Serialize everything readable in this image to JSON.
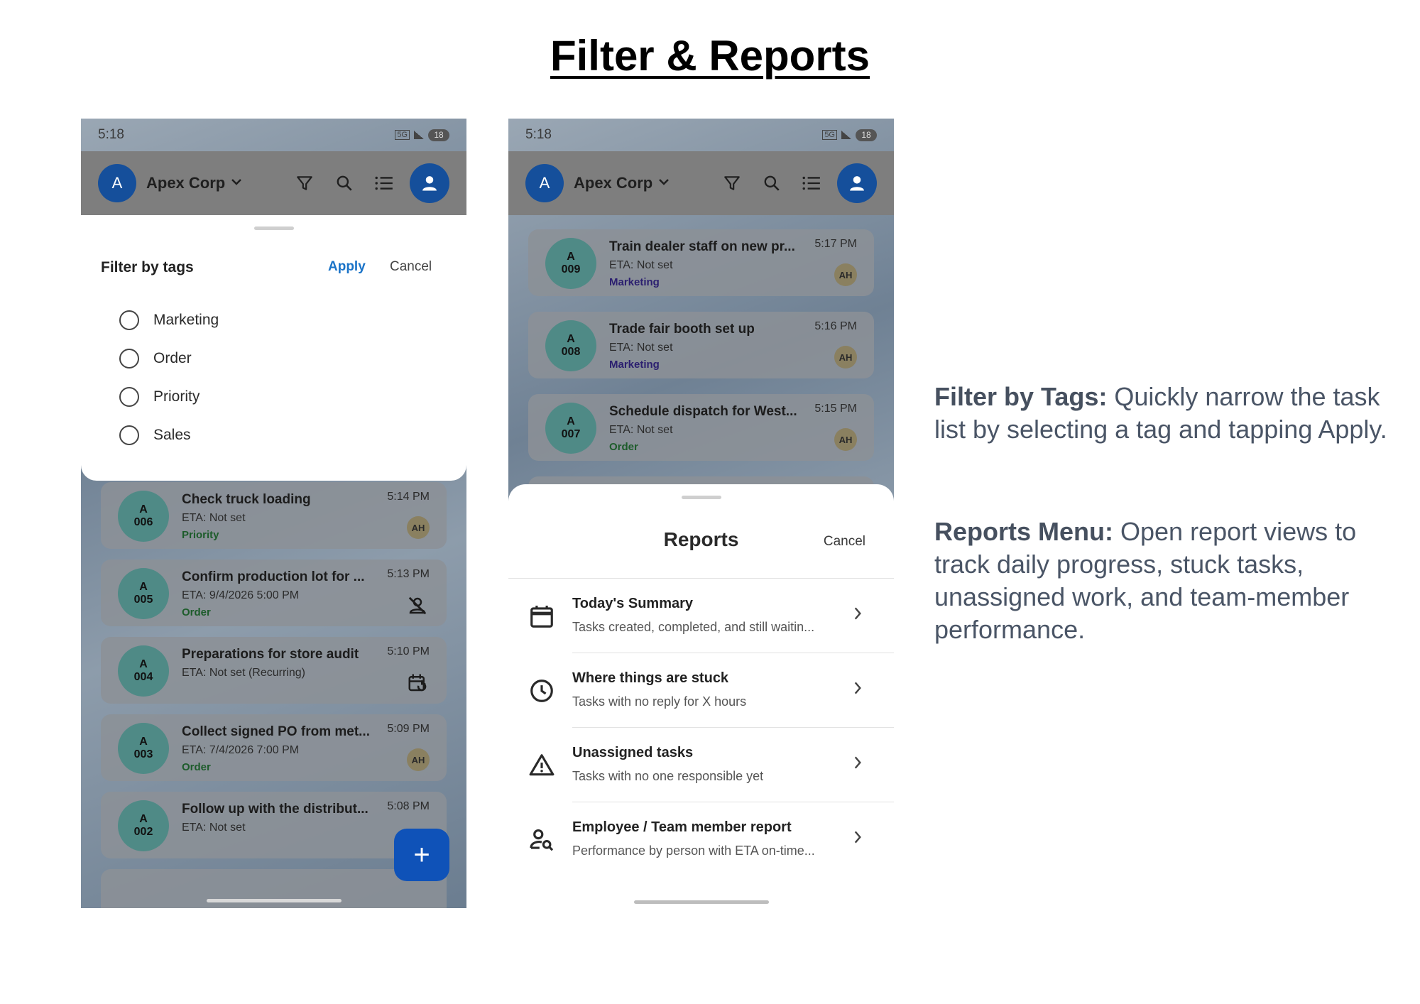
{
  "page": {
    "title": "Filter & Reports"
  },
  "left_phone": {
    "status": {
      "time": "5:18",
      "battery": "18"
    },
    "app_bar": {
      "org_initial": "A",
      "org_name": "Apex Corp"
    },
    "filter_sheet": {
      "title": "Filter by tags",
      "apply_label": "Apply",
      "cancel_label": "Cancel",
      "tags": [
        "Marketing",
        "Order",
        "Priority",
        "Sales"
      ]
    },
    "tasks": [
      {
        "initial": "A",
        "code": "006",
        "title": "Check truck loading",
        "eta": "ETA: Not set",
        "tag": "Priority",
        "time": "5:14 PM",
        "badge": "AH"
      },
      {
        "initial": "A",
        "code": "005",
        "title": "Confirm production lot for ...",
        "eta": "ETA: 9/4/2026 5:00 PM",
        "tag": "Order",
        "time": "5:13 PM",
        "icon": "unassigned-user-icon"
      },
      {
        "initial": "A",
        "code": "004",
        "title": "Preparations for store audit",
        "eta": "ETA: Not set (Recurring)",
        "time": "5:10 PM",
        "icon": "recurring-calendar-icon"
      },
      {
        "initial": "A",
        "code": "003",
        "title": "Collect signed PO from met...",
        "eta": "ETA: 7/4/2026 7:00 PM",
        "tag": "Order",
        "time": "5:09 PM",
        "badge": "AH"
      },
      {
        "initial": "A",
        "code": "002",
        "title": "Follow up with the distribut...",
        "eta": "ETA: Not set",
        "time": "5:08 PM"
      }
    ],
    "fab_label": "+"
  },
  "right_phone": {
    "status": {
      "time": "5:18",
      "battery": "18"
    },
    "app_bar": {
      "org_initial": "A",
      "org_name": "Apex Corp"
    },
    "tasks": [
      {
        "initial": "A",
        "code": "009",
        "title": "Train dealer staff on new pr...",
        "eta": "ETA: Not set",
        "tag": "Marketing",
        "time": "5:17 PM",
        "badge": "AH"
      },
      {
        "initial": "A",
        "code": "008",
        "title": "Trade fair booth set up",
        "eta": "ETA: Not set",
        "tag": "Marketing",
        "time": "5:16 PM",
        "badge": "AH"
      },
      {
        "initial": "A",
        "code": "007",
        "title": "Schedule dispatch for West...",
        "eta": "ETA: Not set",
        "tag": "Order",
        "time": "5:15 PM",
        "badge": "AH"
      }
    ],
    "reports_sheet": {
      "title": "Reports",
      "cancel_label": "Cancel",
      "items": [
        {
          "icon": "calendar-icon",
          "title": "Today's Summary",
          "subtitle": "Tasks created, completed, and still waitin..."
        },
        {
          "icon": "clock-icon",
          "title": "Where things are stuck",
          "subtitle": "Tasks with no reply for X hours"
        },
        {
          "icon": "warning-icon",
          "title": "Unassigned tasks",
          "subtitle": "Tasks with no one responsible yet"
        },
        {
          "icon": "person-search-icon",
          "title": "Employee / Team member report",
          "subtitle": "Performance by person with ETA on-time..."
        }
      ]
    }
  },
  "descriptions": [
    {
      "heading": "Filter by Tags:",
      "text": " Quickly narrow the task list by selecting a tag and tapping Apply."
    },
    {
      "heading": "Reports Menu:",
      "text": " Open report views to track daily progress, stuck tasks, unassigned work, and team-member performance."
    }
  ],
  "colors": {
    "primary_blue": "#154f9b",
    "apply_blue": "#1a73c8",
    "tag_green": "#1d5c2b",
    "tag_purple": "#2c2070",
    "description_text": "#4a5566"
  }
}
